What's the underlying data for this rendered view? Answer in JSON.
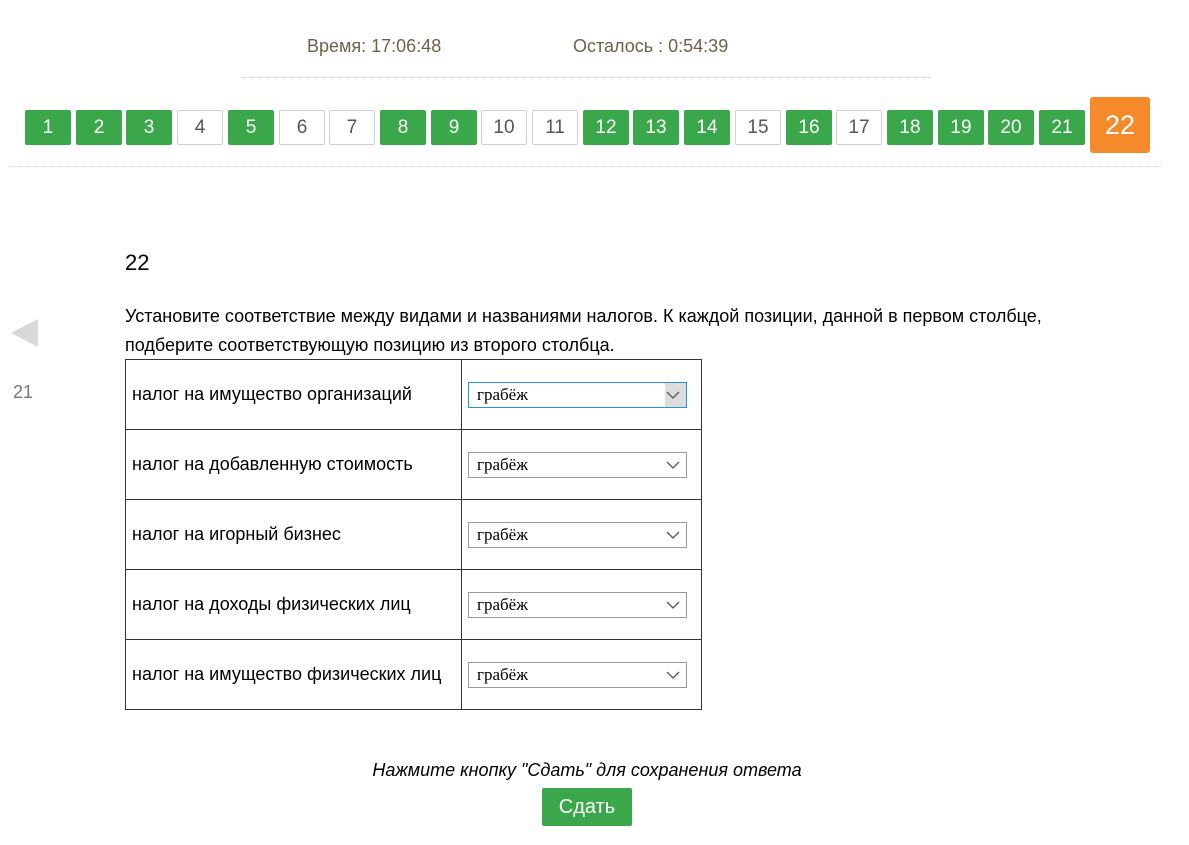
{
  "timer": {
    "time_text": "Время: 17:06:48",
    "remaining_text": "Осталось : 0:54:39"
  },
  "question_nav": [
    {
      "label": "1",
      "state": "done"
    },
    {
      "label": "2",
      "state": "done"
    },
    {
      "label": "3",
      "state": "done"
    },
    {
      "label": "4",
      "state": "todo"
    },
    {
      "label": "5",
      "state": "done"
    },
    {
      "label": "6",
      "state": "todo"
    },
    {
      "label": "7",
      "state": "todo"
    },
    {
      "label": "8",
      "state": "done"
    },
    {
      "label": "9",
      "state": "done"
    },
    {
      "label": "10",
      "state": "todo"
    },
    {
      "label": "11",
      "state": "todo"
    },
    {
      "label": "12",
      "state": "done"
    },
    {
      "label": "13",
      "state": "done"
    },
    {
      "label": "14",
      "state": "done"
    },
    {
      "label": "15",
      "state": "todo"
    },
    {
      "label": "16",
      "state": "done"
    },
    {
      "label": "17",
      "state": "todo"
    },
    {
      "label": "18",
      "state": "done"
    },
    {
      "label": "19",
      "state": "done"
    },
    {
      "label": "20",
      "state": "done"
    },
    {
      "label": "21",
      "state": "done"
    },
    {
      "label": "22",
      "state": "current"
    }
  ],
  "prev": {
    "icon": "triangle-left-icon",
    "label": "21"
  },
  "question": {
    "number": "22",
    "text": "Установите соответствие между видами и названиями налогов. К каждой позиции, данной в первом столбце, подберите соответствующую позицию из второго столбца.",
    "rows": [
      {
        "label": "налог на имущество организаций",
        "selected": "грабёж"
      },
      {
        "label": "налог на добавленную стоимость",
        "selected": "грабёж"
      },
      {
        "label": "налог на игорный бизнес",
        "selected": "грабёж"
      },
      {
        "label": "налог на доходы физических лиц",
        "selected": "грабёж"
      },
      {
        "label": "налог на имущество физических лиц",
        "selected": "грабёж"
      }
    ]
  },
  "footer": {
    "hint": "Нажмите кнопку \"Сдать\" для сохранения ответа",
    "submit_label": "Сдать"
  },
  "colors": {
    "done": "#3aa84a",
    "current": "#f58a2b",
    "timer_text": "#6f6149"
  }
}
